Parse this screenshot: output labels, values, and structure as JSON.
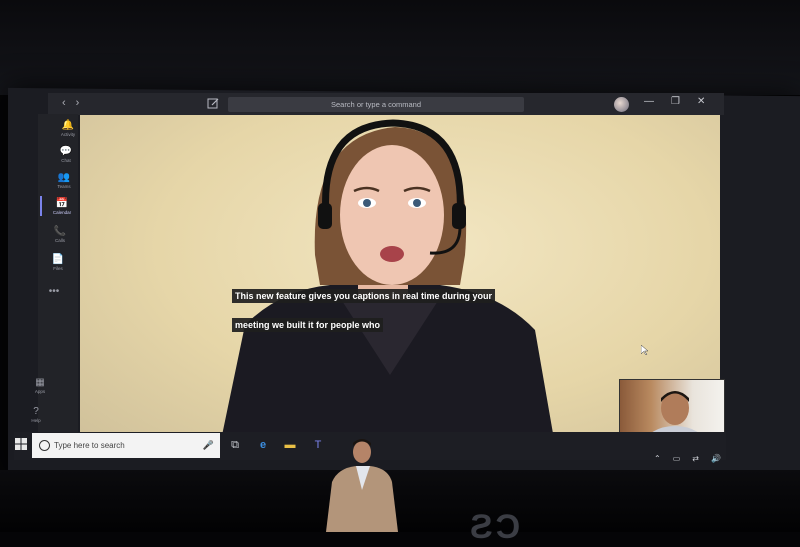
{
  "teams": {
    "search_placeholder": "Search or type a command",
    "nav_back": "‹",
    "nav_forward": "›",
    "window_controls": {
      "minimize": "—",
      "maximize": "❐",
      "close": "✕"
    },
    "rail": [
      {
        "icon": "bell-icon",
        "glyph": "🔔",
        "label": "Activity"
      },
      {
        "icon": "chat-icon",
        "glyph": "💬",
        "label": "Chat"
      },
      {
        "icon": "teams-icon",
        "glyph": "👥",
        "label": "Teams"
      },
      {
        "icon": "calendar-icon",
        "glyph": "📅",
        "label": "Calendar"
      },
      {
        "icon": "calls-icon",
        "glyph": "📞",
        "label": "Calls"
      },
      {
        "icon": "files-icon",
        "glyph": "📄",
        "label": "Files"
      },
      {
        "icon": "more-icon",
        "glyph": "•••",
        "label": ""
      },
      {
        "icon": "apps-icon",
        "glyph": "▦",
        "label": "Apps"
      },
      {
        "icon": "help-icon",
        "glyph": "?",
        "label": "Help"
      }
    ],
    "captions": {
      "line1": "This new feature gives you captions in real time during your",
      "line2": "meeting we built it for people who"
    }
  },
  "taskbar": {
    "search_placeholder": "Type here to search",
    "mic_glyph": "🎤",
    "icons": [
      "task-view-icon",
      "edge-icon",
      "file-explorer-icon",
      "teams-icon"
    ],
    "tray_glyphs": [
      "⌃",
      "▭",
      "⇄",
      "🔊"
    ]
  }
}
